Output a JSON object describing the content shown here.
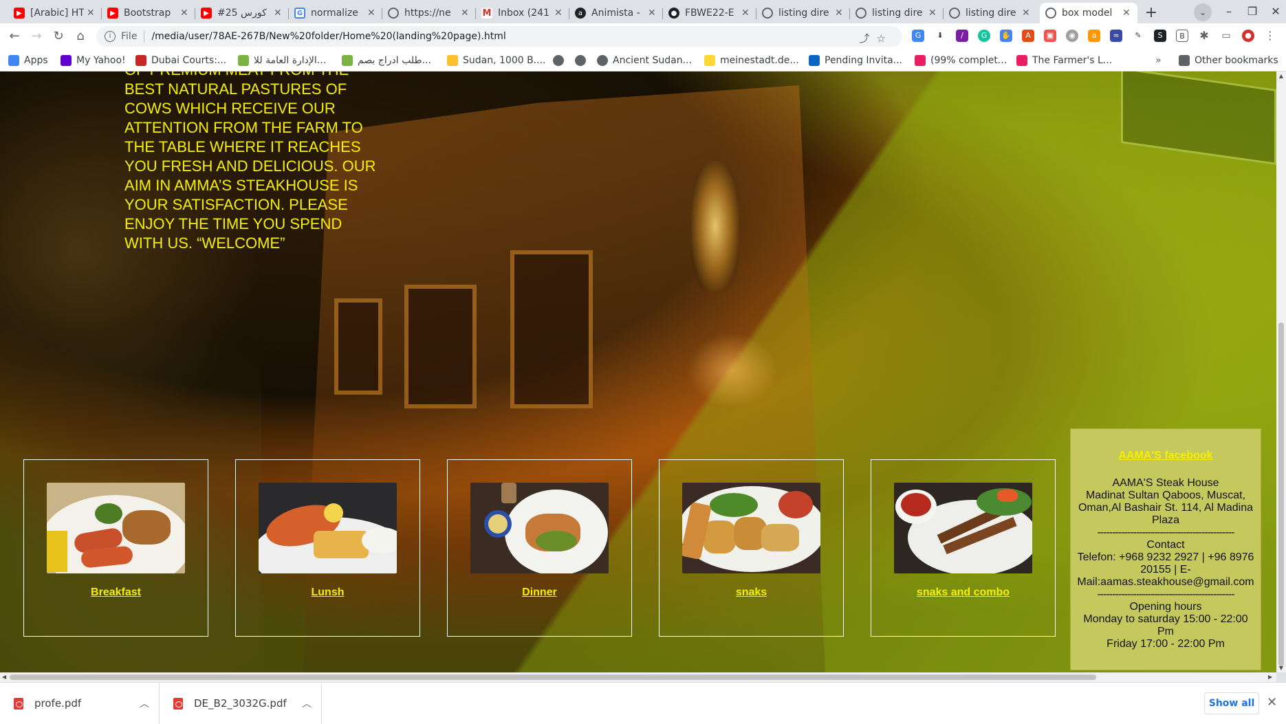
{
  "tabs": [
    {
      "title": "[Arabic] HT",
      "fav": "youtube",
      "color": "#ff0000"
    },
    {
      "title": "Bootstrap",
      "fav": "youtube",
      "color": "#ff0000"
    },
    {
      "title": "#25 كورس",
      "fav": "youtube",
      "color": "#ff0000"
    },
    {
      "title": "normalize",
      "fav": "google",
      "color": "#4285f4"
    },
    {
      "title": "https://ne",
      "fav": "globe",
      "color": "#5f6368"
    },
    {
      "title": "Inbox (241",
      "fav": "gmail",
      "color": "#d93025"
    },
    {
      "title": "Animista -",
      "fav": "animista",
      "color": "#202124"
    },
    {
      "title": "FBWE22-E",
      "fav": "github",
      "color": "#202124"
    },
    {
      "title": "listing dire",
      "fav": "globe",
      "color": "#5f6368"
    },
    {
      "title": "listing dire",
      "fav": "globe",
      "color": "#5f6368"
    },
    {
      "title": "listing dire",
      "fav": "globe",
      "color": "#5f6368"
    },
    {
      "title": "box model",
      "fav": "globe",
      "color": "#5f6368",
      "active": true
    }
  ],
  "toolbar": {
    "scheme": "File",
    "url": "/media/user/78AE-267B/New%20folder/Home%20(landing%20page).html"
  },
  "bookmarks": [
    {
      "label": "Apps",
      "color": "#4285f4"
    },
    {
      "label": "My Yahoo!",
      "color": "#6001d2"
    },
    {
      "label": "Dubai Courts:...",
      "color": "#c62828"
    },
    {
      "label": "الإدارة العامة للا...",
      "color": "#7cb342"
    },
    {
      "label": "طلب ادراج بصم...",
      "color": "#7cb342"
    },
    {
      "label": "Sudan, 1000 B....",
      "color": "#fbc02d"
    },
    {
      "label": "",
      "color": "#5f6368"
    },
    {
      "label": "",
      "color": "#5f6368"
    },
    {
      "label": "Ancient Sudan...",
      "color": "#5f6368"
    },
    {
      "label": "meinestadt.de...",
      "color": "#fdd835"
    },
    {
      "label": "Pending Invita...",
      "color": "#0a66c2"
    },
    {
      "label": "(99% complet...",
      "color": "#e91e63"
    },
    {
      "label": "The Farmer's L...",
      "color": "#e91e63"
    }
  ],
  "other_bookmarks": "Other bookmarks",
  "page": {
    "about_text": "OF PREMIUM MEAT FROM THE BEST NATURAL PASTURES OF COWS WHICH RECEIVE OUR ATTENTION FROM THE FARM TO THE TABLE WHERE IT REACHES YOU FRESH AND DELICIOUS. OUR AIM IN AMMA’S STEAKHOUSE IS YOUR SATISFACTION. PLEASE ENJOY THE TIME YOU SPEND WITH US. “WELCOME”",
    "menu": [
      {
        "label": "Breakfast"
      },
      {
        "label": "Lunsh"
      },
      {
        "label": "Dinner"
      },
      {
        "label": "snaks"
      },
      {
        "label": "snaks and combo"
      }
    ],
    "contact": {
      "facebook": "AAMA'S facebook",
      "name": "AAMA'S Steak House",
      "address": "Madinat Sultan Qaboos, Muscat, Oman,Al Bashair St. 114, Al Madina Plaza",
      "separator": "----------------------------------------------",
      "contact_heading": "Contact",
      "contact_details": "Telefon: +968 9232 2927 | +96 8976 20155 | E-Mail:aamas.steakhouse@gmail.com",
      "hours_heading": "Opening hours",
      "hours_weekdays": "Monday to saturday 15:00 - 22:00 Pm",
      "hours_friday": "Friday 17:00 - 22:00 Pm"
    }
  },
  "downloads": [
    {
      "file": "profe.pdf"
    },
    {
      "file": "DE_B2_3032G.pdf"
    }
  ],
  "downloads_show_all": "Show all"
}
